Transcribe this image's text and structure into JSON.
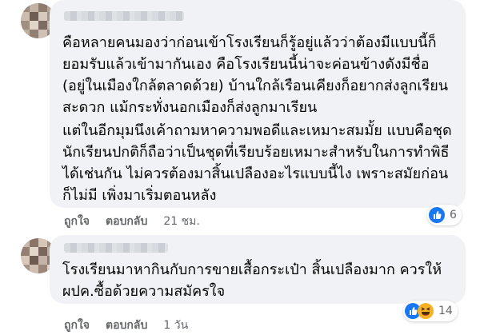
{
  "comments": [
    {
      "paragraphs": [
        "คือหลายคนมองว่าก่อนเข้าโรงเรียนก็รู้อยู่แล้วว่าต้องมีแบบนี้ก็ยอมรับแล้วเข้ามากันเอง คือโรงเรียนนี้น่าจะค่อนข้างดังมีชื่อ (อยู่ในเมืองใกล้ตลาดด้วย) บ้านใกล้เรือนเคียงก็อยากส่งลูกเรียนสะดวก แม้กระทั่งนอกเมืองก็ส่งลูกมาเรียน",
        "แต่ในอีกมุมนึงเค้าถามหาความพอดีและเหมาะสมมั้ย แบบคือชุดนักเรียนปกติก็ถือว่าเป็นชุดที่เรียบร้อยเหมาะสำหรับในการทำพิธีได้เช่นกัน ไม่ควรต้องมาสิ้นเปลืองอะไรแบบนี้ไง เพราะสมัยก่อนก็ไม่มี เพิ่งมาเริ่มตอนหลัง"
      ],
      "like_label": "ถูกใจ",
      "reply_label": "ตอบกลับ",
      "time": "21 ชม.",
      "reactions": [
        "like-icon"
      ],
      "reaction_count": "6"
    },
    {
      "paragraphs": [
        "โรงเรียนมาหากินกับการขายเสื้อกระเป๋า สิ้นเปลืองมาก ควรให้ผปค.ซื้อด้วยความสมัครใจ"
      ],
      "like_label": "ถูกใจ",
      "reply_label": "ตอบกลับ",
      "time": "1 วัน",
      "reactions": [
        "like-icon",
        "haha-icon"
      ],
      "reaction_count": "14"
    }
  ],
  "colors": {
    "bubble": "#f0f2f5",
    "meta_text": "#65676b",
    "like_blue": "#1877f2",
    "haha_yellow": "#f7b125"
  }
}
